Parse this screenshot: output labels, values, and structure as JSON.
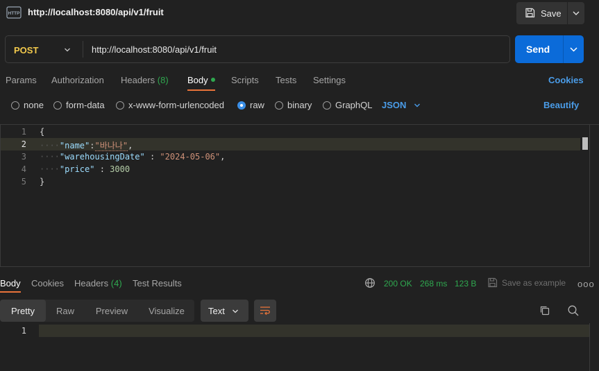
{
  "title": {
    "url": "http://localhost:8080/api/v1/fruit",
    "icon": "http-icon"
  },
  "save": {
    "label": "Save"
  },
  "request": {
    "method": "POST",
    "url": "http://localhost:8080/api/v1/fruit",
    "send_label": "Send"
  },
  "tabs": {
    "params": "Params",
    "authorization": "Authorization",
    "headers": "Headers",
    "headers_count": "(8)",
    "body": "Body",
    "scripts": "Scripts",
    "tests": "Tests",
    "settings": "Settings",
    "cookies": "Cookies"
  },
  "body_modes": {
    "none": "none",
    "form_data": "form-data",
    "urlencoded": "x-www-form-urlencoded",
    "raw": "raw",
    "binary": "binary",
    "graphql": "GraphQL",
    "selected": "raw",
    "language": "JSON",
    "beautify": "Beautify"
  },
  "editor": {
    "lines": [
      {
        "n": "1",
        "open": "{"
      },
      {
        "n": "2",
        "key": "\"name\"",
        "sep": ":",
        "val": "\"바나나\"",
        "tail": ","
      },
      {
        "n": "3",
        "key": "\"warehousingDate\"",
        "sep": " : ",
        "val": "\"2024-05-06\"",
        "tail": ","
      },
      {
        "n": "4",
        "key": "\"price\"",
        "sep": " : ",
        "val": "3000",
        "tail": ""
      },
      {
        "n": "5",
        "close": "}"
      }
    ],
    "current_line": "2"
  },
  "response": {
    "tabs": {
      "body": "Body",
      "cookies": "Cookies",
      "headers": "Headers",
      "headers_count": "(4)",
      "test_results": "Test Results"
    },
    "status": "200 OK",
    "time": "268 ms",
    "size": "123 B",
    "save_example": "Save as example",
    "more": "ooo",
    "views": {
      "pretty": "Pretty",
      "raw": "Raw",
      "preview": "Preview",
      "visualize": "Visualize"
    },
    "format": "Text",
    "line1": "1"
  },
  "colors": {
    "accent_orange": "#e8733a",
    "link_blue": "#4a9ce8",
    "send_blue": "#0b6bd9",
    "post_yellow": "#f2c94c",
    "ok_green": "#2fa84f"
  }
}
